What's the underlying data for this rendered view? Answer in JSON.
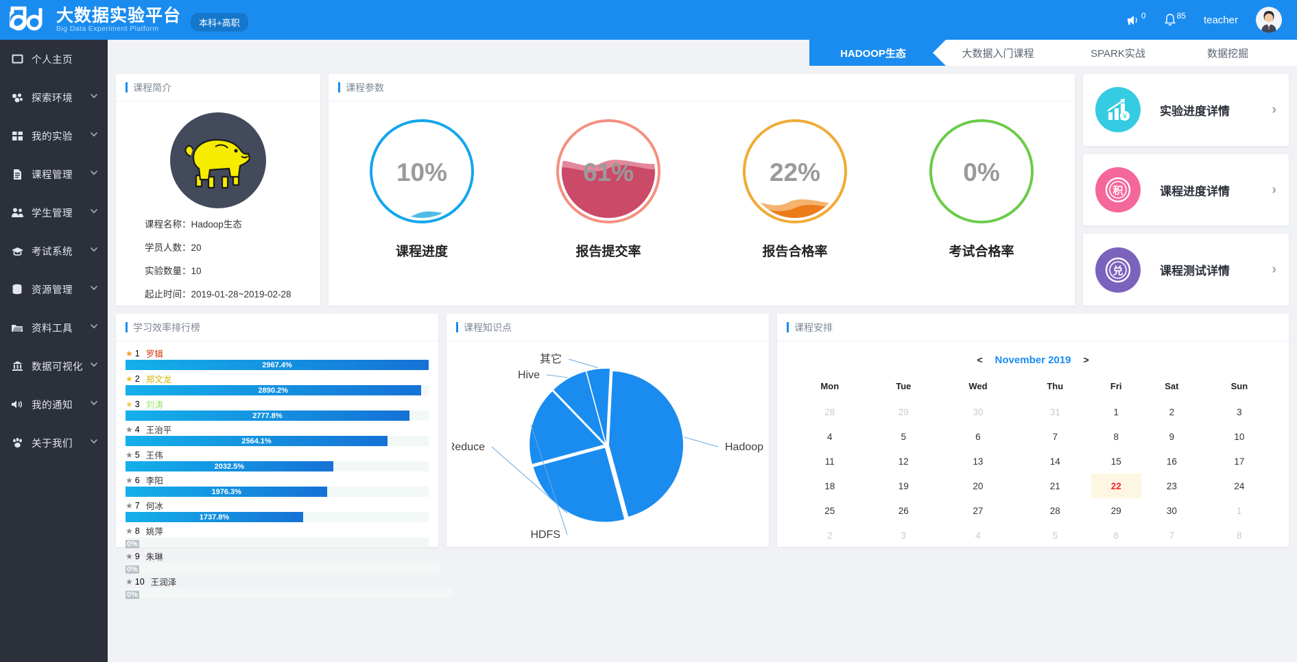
{
  "header": {
    "logo_cn": "大数据实验平台",
    "logo_en": "Big Data Experiment Platform",
    "badge": "本科+高职",
    "megaphone_count": "0",
    "bell_count": "85",
    "user": "teacher"
  },
  "sidebar": {
    "items": [
      {
        "label": "个人主页",
        "icon": "home-icon",
        "expandable": false
      },
      {
        "label": "探索环境",
        "icon": "explore-icon",
        "expandable": true
      },
      {
        "label": "我的实验",
        "icon": "grid-icon",
        "expandable": true
      },
      {
        "label": "课程管理",
        "icon": "document-icon",
        "expandable": true
      },
      {
        "label": "学生管理",
        "icon": "users-icon",
        "expandable": true
      },
      {
        "label": "考试系统",
        "icon": "graduation-cap-icon",
        "expandable": true
      },
      {
        "label": "资源管理",
        "icon": "database-icon",
        "expandable": true
      },
      {
        "label": "资料工具",
        "icon": "folder-icon",
        "expandable": true
      },
      {
        "label": "数据可视化",
        "icon": "bank-icon",
        "expandable": true
      },
      {
        "label": "我的通知",
        "icon": "speaker-icon",
        "expandable": true
      },
      {
        "label": "关于我们",
        "icon": "paw-icon",
        "expandable": true
      }
    ]
  },
  "tabs": [
    {
      "label": "HADOOP生态",
      "active": true
    },
    {
      "label": "大数据入门课程",
      "active": false
    },
    {
      "label": "SPARK实战",
      "active": false
    },
    {
      "label": "数据挖掘",
      "active": false
    }
  ],
  "intro": {
    "title": "课程简介",
    "course_name": "课程名称：Hadoop生态",
    "student_count": "学员人数：20",
    "experiment_count": "实验数量：10",
    "date_range": "起止时间：2019-01-28~2019-02-28"
  },
  "params": {
    "title": "课程参数",
    "gauges": [
      {
        "label": "课程进度",
        "value": "10%",
        "percent": 10,
        "color": "#13a6ec",
        "wave": "#1772d1",
        "wave2": "#14a4de"
      },
      {
        "label": "报告提交率",
        "value": "61%",
        "percent": 61,
        "color": "#f4907f",
        "wave": "#cb4a68",
        "wave2": "#d9607a"
      },
      {
        "label": "报告合格率",
        "value": "22%",
        "percent": 22,
        "color": "#f0ab35",
        "wave": "#ec7b1a",
        "wave2": "#f19a3c"
      },
      {
        "label": "考试合格率",
        "value": "0%",
        "percent": 3,
        "color": "#6ccb49",
        "wave": "#3f7d46",
        "wave2": "#4f9551"
      }
    ]
  },
  "actions": [
    {
      "label": "实验进度详情",
      "icon": "chart-growth-icon",
      "color": "#35cbe2",
      "glyph": "￥"
    },
    {
      "label": "课程进度详情",
      "icon": "points-icon",
      "color": "#f5679a",
      "glyph": "积"
    },
    {
      "label": "课程测试详情",
      "icon": "exchange-icon",
      "color": "#7b63bd",
      "glyph": "兑"
    }
  ],
  "ranking": {
    "title": "学习效率排行榜",
    "items": [
      {
        "rank": "1",
        "name": "罗辑",
        "value": "2967.4%",
        "pct": 100,
        "star": "#f0a020",
        "name_color": "#d4380d"
      },
      {
        "rank": "2",
        "name": "郑文龙",
        "value": "2890.2%",
        "pct": 97.4,
        "star": "#f0c020",
        "name_color": "#d4b106"
      },
      {
        "rank": "3",
        "name": "刘涛",
        "value": "2777.8%",
        "pct": 93.6,
        "star": "#f5c842",
        "name_color": "#95de64"
      },
      {
        "rank": "4",
        "name": "王治平",
        "value": "2564.1%",
        "pct": 86.4,
        "star": "#8c8c8c",
        "name_color": "#333"
      },
      {
        "rank": "5",
        "name": "王伟",
        "value": "2032.5%",
        "pct": 68.5,
        "star": "#8c8c8c",
        "name_color": "#333"
      },
      {
        "rank": "6",
        "name": "李阳",
        "value": "1976.3%",
        "pct": 66.6,
        "star": "#8c8c8c",
        "name_color": "#333"
      },
      {
        "rank": "7",
        "name": "何冰",
        "value": "1737.8%",
        "pct": 58.6,
        "star": "#8c8c8c",
        "name_color": "#333"
      },
      {
        "rank": "8",
        "name": "姚萍",
        "value": "0%",
        "pct": 0,
        "star": "#8c8c8c",
        "name_color": "#333"
      },
      {
        "rank": "9",
        "name": "朱琳",
        "value": "0%",
        "pct": 0,
        "star": "#8c8c8c",
        "name_color": "#333"
      },
      {
        "rank": "10",
        "name": "王润泽",
        "value": "0%",
        "pct": 0,
        "star": "#8c8c8c",
        "name_color": "#333"
      }
    ]
  },
  "knowledge": {
    "title": "课程知识点"
  },
  "chart_data": [
    {
      "type": "bar",
      "title": "学习效率排行榜",
      "orientation": "horizontal",
      "categories": [
        "罗辑",
        "郑文龙",
        "刘涛",
        "王治平",
        "王伟",
        "李阳",
        "何冰",
        "姚萍",
        "朱琳",
        "王润泽"
      ],
      "values": [
        2967.4,
        2890.2,
        2777.8,
        2564.1,
        2032.5,
        1976.3,
        1737.8,
        0,
        0,
        0
      ],
      "xlabel": "",
      "ylabel": "",
      "unit": "%",
      "grid": false,
      "legend": false
    },
    {
      "type": "pie",
      "title": "课程知识点",
      "labels": [
        "Hadoop",
        "MapReduce",
        "HDFS",
        "Hive",
        "其它"
      ],
      "values": [
        45,
        25,
        17,
        8,
        5
      ],
      "colors": [
        "#1a8cf0",
        "#1a8cf0",
        "#1a8cf0",
        "#1a8cf0",
        "#1a8cf0"
      ],
      "legend": "labels-outside"
    },
    {
      "type": "pie",
      "title": "课程参数",
      "labels": [
        "课程进度",
        "报告提交率",
        "报告合格率",
        "考试合格率"
      ],
      "values": [
        10,
        61,
        22,
        0
      ],
      "unit": "%",
      "style": "liquid-fill-gauge"
    }
  ],
  "calendar": {
    "title": "课程安排",
    "prev": "<",
    "next": ">",
    "month": "November 2019",
    "weekdays": [
      "Mon",
      "Tue",
      "Wed",
      "Thu",
      "Fri",
      "Sat",
      "Sun"
    ],
    "weeks": [
      [
        {
          "d": "28",
          "muted": true
        },
        {
          "d": "29",
          "muted": true
        },
        {
          "d": "30",
          "muted": true
        },
        {
          "d": "31",
          "muted": true
        },
        {
          "d": "1"
        },
        {
          "d": "2"
        },
        {
          "d": "3"
        }
      ],
      [
        {
          "d": "4"
        },
        {
          "d": "5"
        },
        {
          "d": "6"
        },
        {
          "d": "7"
        },
        {
          "d": "8"
        },
        {
          "d": "9"
        },
        {
          "d": "10"
        }
      ],
      [
        {
          "d": "11"
        },
        {
          "d": "12"
        },
        {
          "d": "13"
        },
        {
          "d": "14"
        },
        {
          "d": "15"
        },
        {
          "d": "16"
        },
        {
          "d": "17"
        }
      ],
      [
        {
          "d": "18"
        },
        {
          "d": "19"
        },
        {
          "d": "20"
        },
        {
          "d": "21"
        },
        {
          "d": "22",
          "today": true
        },
        {
          "d": "23"
        },
        {
          "d": "24"
        }
      ],
      [
        {
          "d": "25"
        },
        {
          "d": "26"
        },
        {
          "d": "27"
        },
        {
          "d": "28"
        },
        {
          "d": "29"
        },
        {
          "d": "30"
        },
        {
          "d": "1",
          "muted": true
        }
      ],
      [
        {
          "d": "2",
          "muted": true
        },
        {
          "d": "3",
          "muted": true
        },
        {
          "d": "4",
          "muted": true
        },
        {
          "d": "5",
          "muted": true
        },
        {
          "d": "6",
          "muted": true
        },
        {
          "d": "7",
          "muted": true
        },
        {
          "d": "8",
          "muted": true
        }
      ]
    ]
  }
}
